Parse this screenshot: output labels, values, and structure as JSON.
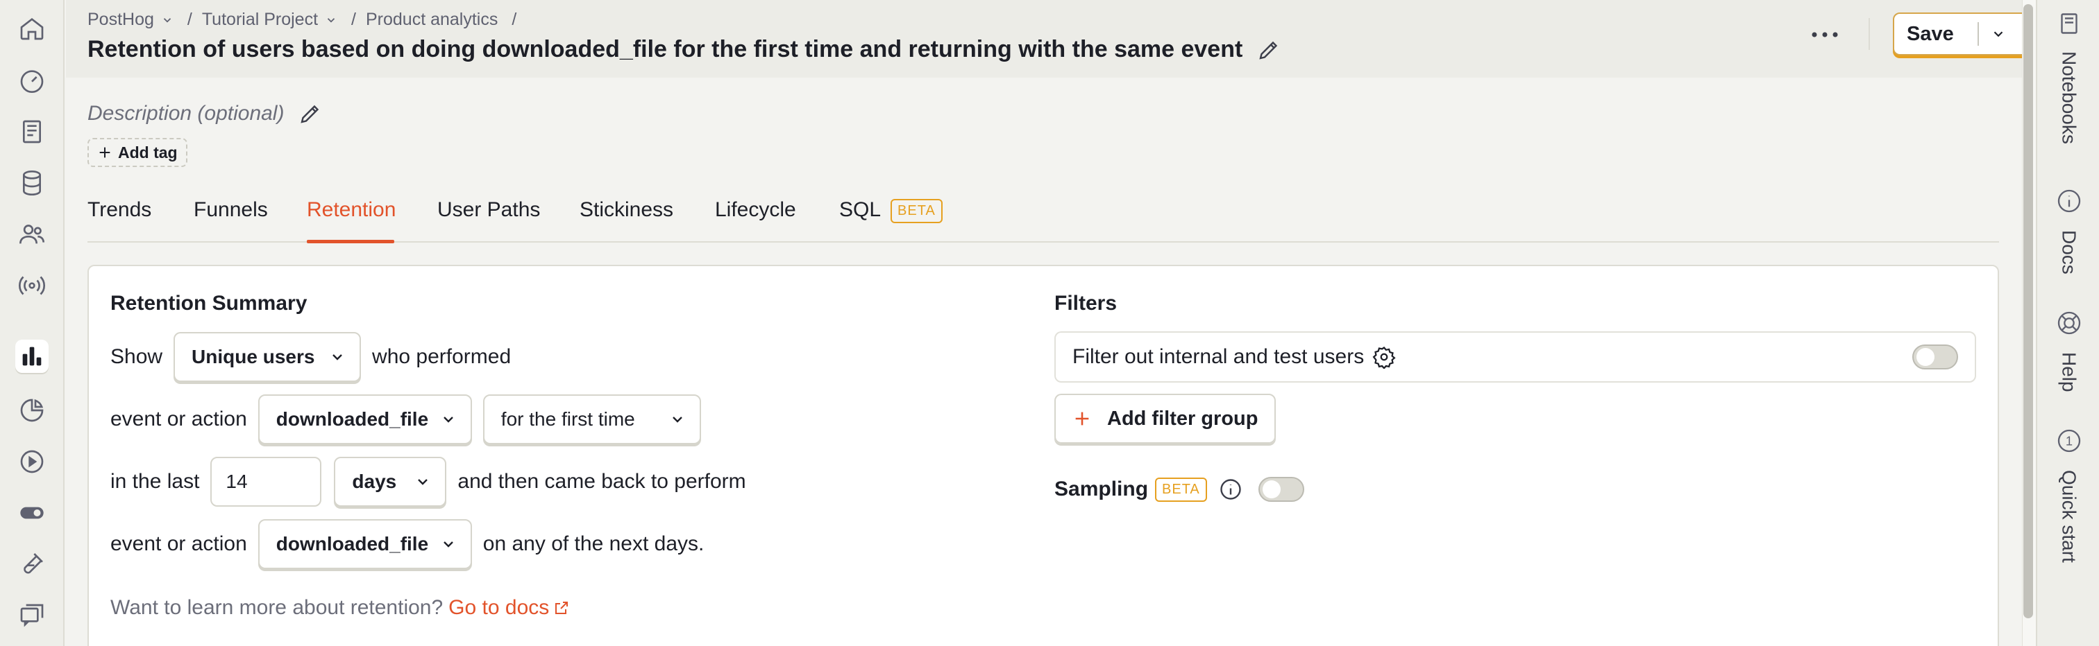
{
  "nav": {
    "items": [
      {
        "name": "home-icon"
      },
      {
        "name": "dashboards-icon"
      },
      {
        "name": "notebooks-icon"
      },
      {
        "name": "data-management-icon"
      },
      {
        "name": "people-icon"
      },
      {
        "name": "activity-icon"
      },
      {
        "name": "product-analytics-icon"
      },
      {
        "name": "web-analytics-icon"
      },
      {
        "name": "session-replay-icon"
      },
      {
        "name": "feature-flags-icon"
      },
      {
        "name": "experiments-icon"
      },
      {
        "name": "surveys-icon"
      }
    ],
    "active_index": 6
  },
  "breadcrumbs": {
    "org": "PostHog",
    "project": "Tutorial Project",
    "section": "Product analytics"
  },
  "title": "Retention of users based on doing downloaded_file for the first time and returning with the same event",
  "header": {
    "save_label": "Save"
  },
  "description_placeholder": "Description (optional)",
  "add_tag_label": "Add tag",
  "tabs": [
    {
      "label": "Trends"
    },
    {
      "label": "Funnels"
    },
    {
      "label": "Retention"
    },
    {
      "label": "User Paths"
    },
    {
      "label": "Stickiness"
    },
    {
      "label": "Lifecycle"
    },
    {
      "label": "SQL"
    }
  ],
  "active_tab": "Retention",
  "beta_label": "BETA",
  "summary": {
    "heading": "Retention Summary",
    "show_label": "Show",
    "show_value": "Unique users",
    "who_performed": "who performed",
    "event_or_action": "event or action",
    "target_event": "downloaded_file",
    "first_time_value": "for the first time",
    "in_the_last": "in the last",
    "period_count": "14",
    "period_unit": "days",
    "came_back": "and then came back to perform",
    "return_event": "downloaded_file",
    "next_days": "on any of the next days.",
    "learn_more": "Want to learn more about retention?",
    "docs_link": "Go to docs"
  },
  "filters": {
    "heading": "Filters",
    "test_users_label": "Filter out internal and test users",
    "add_group_label": "Add filter group",
    "sampling_label": "Sampling"
  },
  "right_panel": [
    {
      "label": "Notebooks",
      "icon": "notebook-icon"
    },
    {
      "label": "Docs",
      "icon": "info-icon"
    },
    {
      "label": "Help",
      "icon": "lifebuoy-icon"
    },
    {
      "label": "Quick start",
      "icon": "1",
      "badge": "1"
    }
  ],
  "colors": {
    "accent": "#e2532b",
    "beta": "#e6a020",
    "save_shadow": "#e6a020"
  }
}
